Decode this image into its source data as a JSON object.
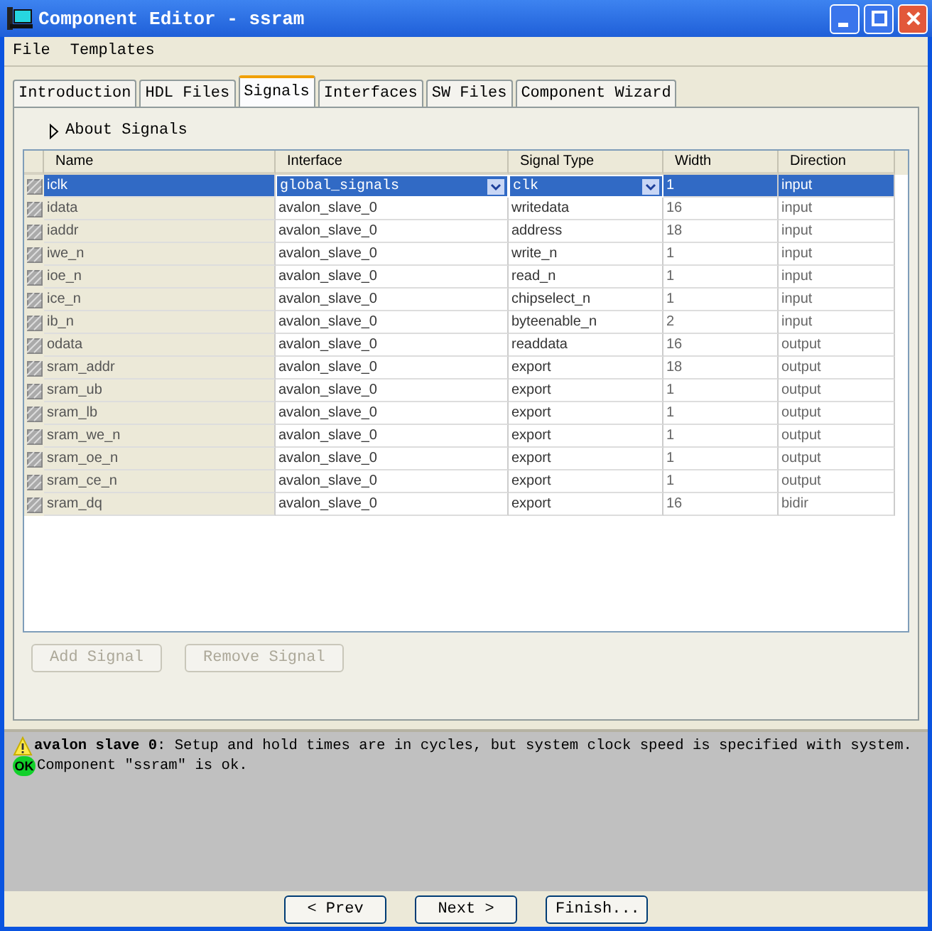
{
  "window": {
    "title": "Component Editor - ssram"
  },
  "menu": [
    "File",
    "Templates"
  ],
  "tabs": [
    {
      "label": "Introduction",
      "selected": false
    },
    {
      "label": "HDL Files",
      "selected": false
    },
    {
      "label": "Signals",
      "selected": true
    },
    {
      "label": "Interfaces",
      "selected": false
    },
    {
      "label": "SW Files",
      "selected": false
    },
    {
      "label": "Component Wizard",
      "selected": false
    }
  ],
  "about": {
    "label": "About Signals",
    "expanded": false
  },
  "table": {
    "columns": [
      "Name",
      "Interface",
      "Signal Type",
      "Width",
      "Direction"
    ],
    "rows": [
      {
        "cells": [
          "iclk",
          "global_signals",
          "clk",
          "1",
          "input"
        ],
        "selected": true
      },
      {
        "cells": [
          "idata",
          "avalon_slave_0",
          "writedata",
          "16",
          "input"
        ],
        "selected": false
      },
      {
        "cells": [
          "iaddr",
          "avalon_slave_0",
          "address",
          "18",
          "input"
        ],
        "selected": false
      },
      {
        "cells": [
          "iwe_n",
          "avalon_slave_0",
          "write_n",
          "1",
          "input"
        ],
        "selected": false
      },
      {
        "cells": [
          "ioe_n",
          "avalon_slave_0",
          "read_n",
          "1",
          "input"
        ],
        "selected": false
      },
      {
        "cells": [
          "ice_n",
          "avalon_slave_0",
          "chipselect_n",
          "1",
          "input"
        ],
        "selected": false
      },
      {
        "cells": [
          "ib_n",
          "avalon_slave_0",
          "byteenable_n",
          "2",
          "input"
        ],
        "selected": false
      },
      {
        "cells": [
          "odata",
          "avalon_slave_0",
          "readdata",
          "16",
          "output"
        ],
        "selected": false
      },
      {
        "cells": [
          "sram_addr",
          "avalon_slave_0",
          "export",
          "18",
          "output"
        ],
        "selected": false
      },
      {
        "cells": [
          "sram_ub",
          "avalon_slave_0",
          "export",
          "1",
          "output"
        ],
        "selected": false
      },
      {
        "cells": [
          "sram_lb",
          "avalon_slave_0",
          "export",
          "1",
          "output"
        ],
        "selected": false
      },
      {
        "cells": [
          "sram_we_n",
          "avalon_slave_0",
          "export",
          "1",
          "output"
        ],
        "selected": false
      },
      {
        "cells": [
          "sram_oe_n",
          "avalon_slave_0",
          "export",
          "1",
          "output"
        ],
        "selected": false
      },
      {
        "cells": [
          "sram_ce_n",
          "avalon_slave_0",
          "export",
          "1",
          "output"
        ],
        "selected": false
      },
      {
        "cells": [
          "sram_dq",
          "avalon_slave_0",
          "export",
          "16",
          "bidir"
        ],
        "selected": false
      }
    ]
  },
  "table_buttons": [
    {
      "label": "Add Signal",
      "disabled": true
    },
    {
      "label": "Remove Signal",
      "disabled": true
    }
  ],
  "messages": [
    {
      "kind": "warning",
      "text": "**avalon slave 0**: Setup and hold times are in cycles, but system clock speed is specified with system."
    },
    {
      "kind": "ok",
      "badge": "OK",
      "text": "Component \"ssram\" is ok."
    }
  ],
  "footer_buttons": [
    {
      "label": "< Prev"
    },
    {
      "label": "Next >"
    },
    {
      "label": "Finish..."
    }
  ]
}
